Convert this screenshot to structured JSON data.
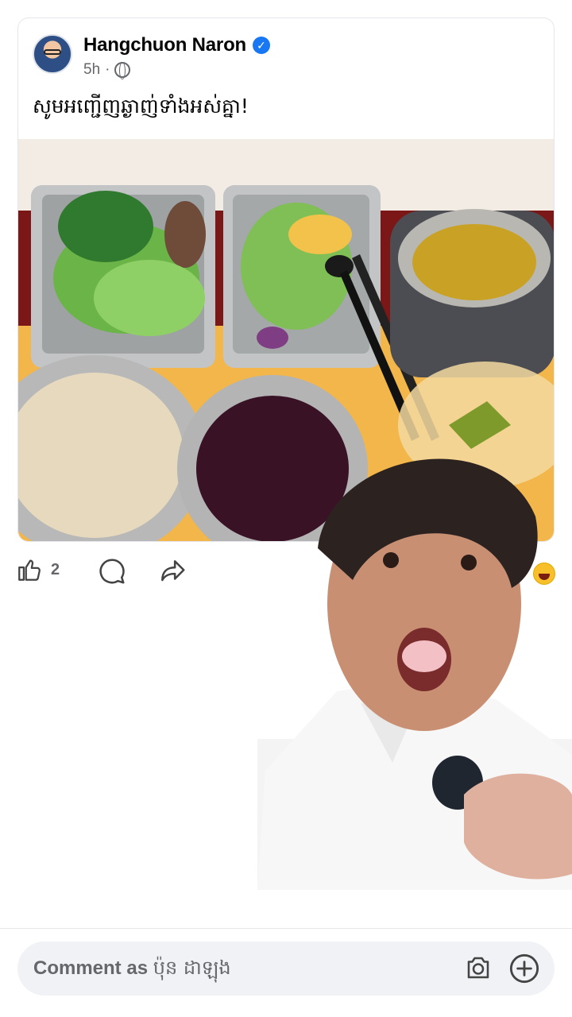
{
  "post": {
    "author": "Hangchuon Naron",
    "verified": true,
    "time": "5h",
    "separator": "·",
    "privacy_icon": "globe-icon",
    "text": "សូមអញ្ជើញឆ្ងាញ់ទាំងអស់គ្នា!",
    "photo_description": "food-photo"
  },
  "reactions": {
    "like_count": "2",
    "like_icon": "like-icon",
    "comment_icon": "comment-icon",
    "share_icon": "share-icon",
    "reaction_emoji": "laugh-icon"
  },
  "composer": {
    "placeholder_prefix": "Comment as",
    "placeholder_name": "ប៉ុន ដាឡុង",
    "camera_icon": "camera-icon",
    "plus_icon": "plus-icon"
  },
  "colors": {
    "verified_blue": "#1877f2",
    "meta_gray": "#65676b",
    "composer_bg": "#f0f2f5"
  }
}
